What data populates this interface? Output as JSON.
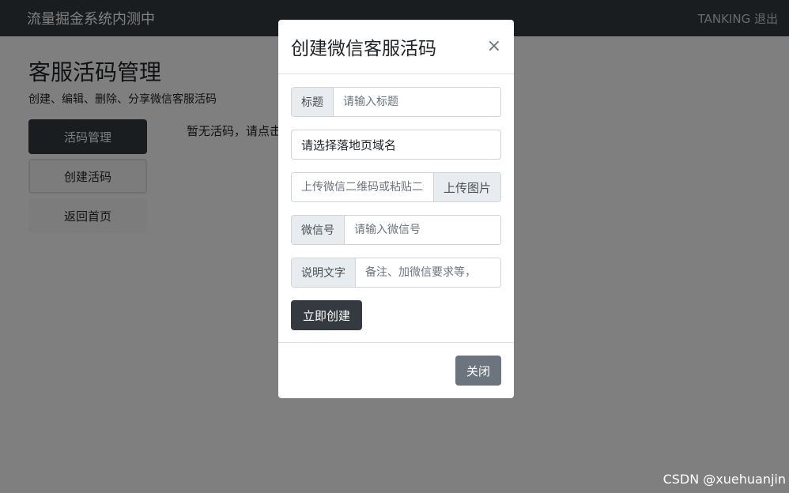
{
  "navbar": {
    "brand": "流量掘金系统内测中",
    "user": "TANKING",
    "logout": "退出"
  },
  "page": {
    "title": "客服活码管理",
    "subtitle": "创建、编辑、删除、分享微信客服活码",
    "empty_message": "暂无活码，请点击"
  },
  "sidebar": {
    "items": [
      {
        "label": "活码管理"
      },
      {
        "label": "创建活码"
      },
      {
        "label": "返回首页"
      }
    ]
  },
  "modal": {
    "title": "创建微信客服活码",
    "close_icon": "close-icon",
    "fields": {
      "title_label": "标题",
      "title_placeholder": "请输入标题",
      "domain_select": "请选择落地页域名",
      "qrcode_placeholder": "上传微信二维码或粘贴二维码链接",
      "upload_label": "上传图片",
      "wechat_label": "微信号",
      "wechat_placeholder": "请输入微信号",
      "desc_label": "说明文字",
      "desc_placeholder": "备注、加微信要求等，"
    },
    "submit_label": "立即创建",
    "close_label": "关闭"
  },
  "watermark": "CSDN @xuehuanjin",
  "colors": {
    "navbar": "#343a40",
    "primary_dark": "#343a40",
    "secondary": "#6c757d",
    "backdrop": "rgba(0,0,0,0.5)"
  }
}
